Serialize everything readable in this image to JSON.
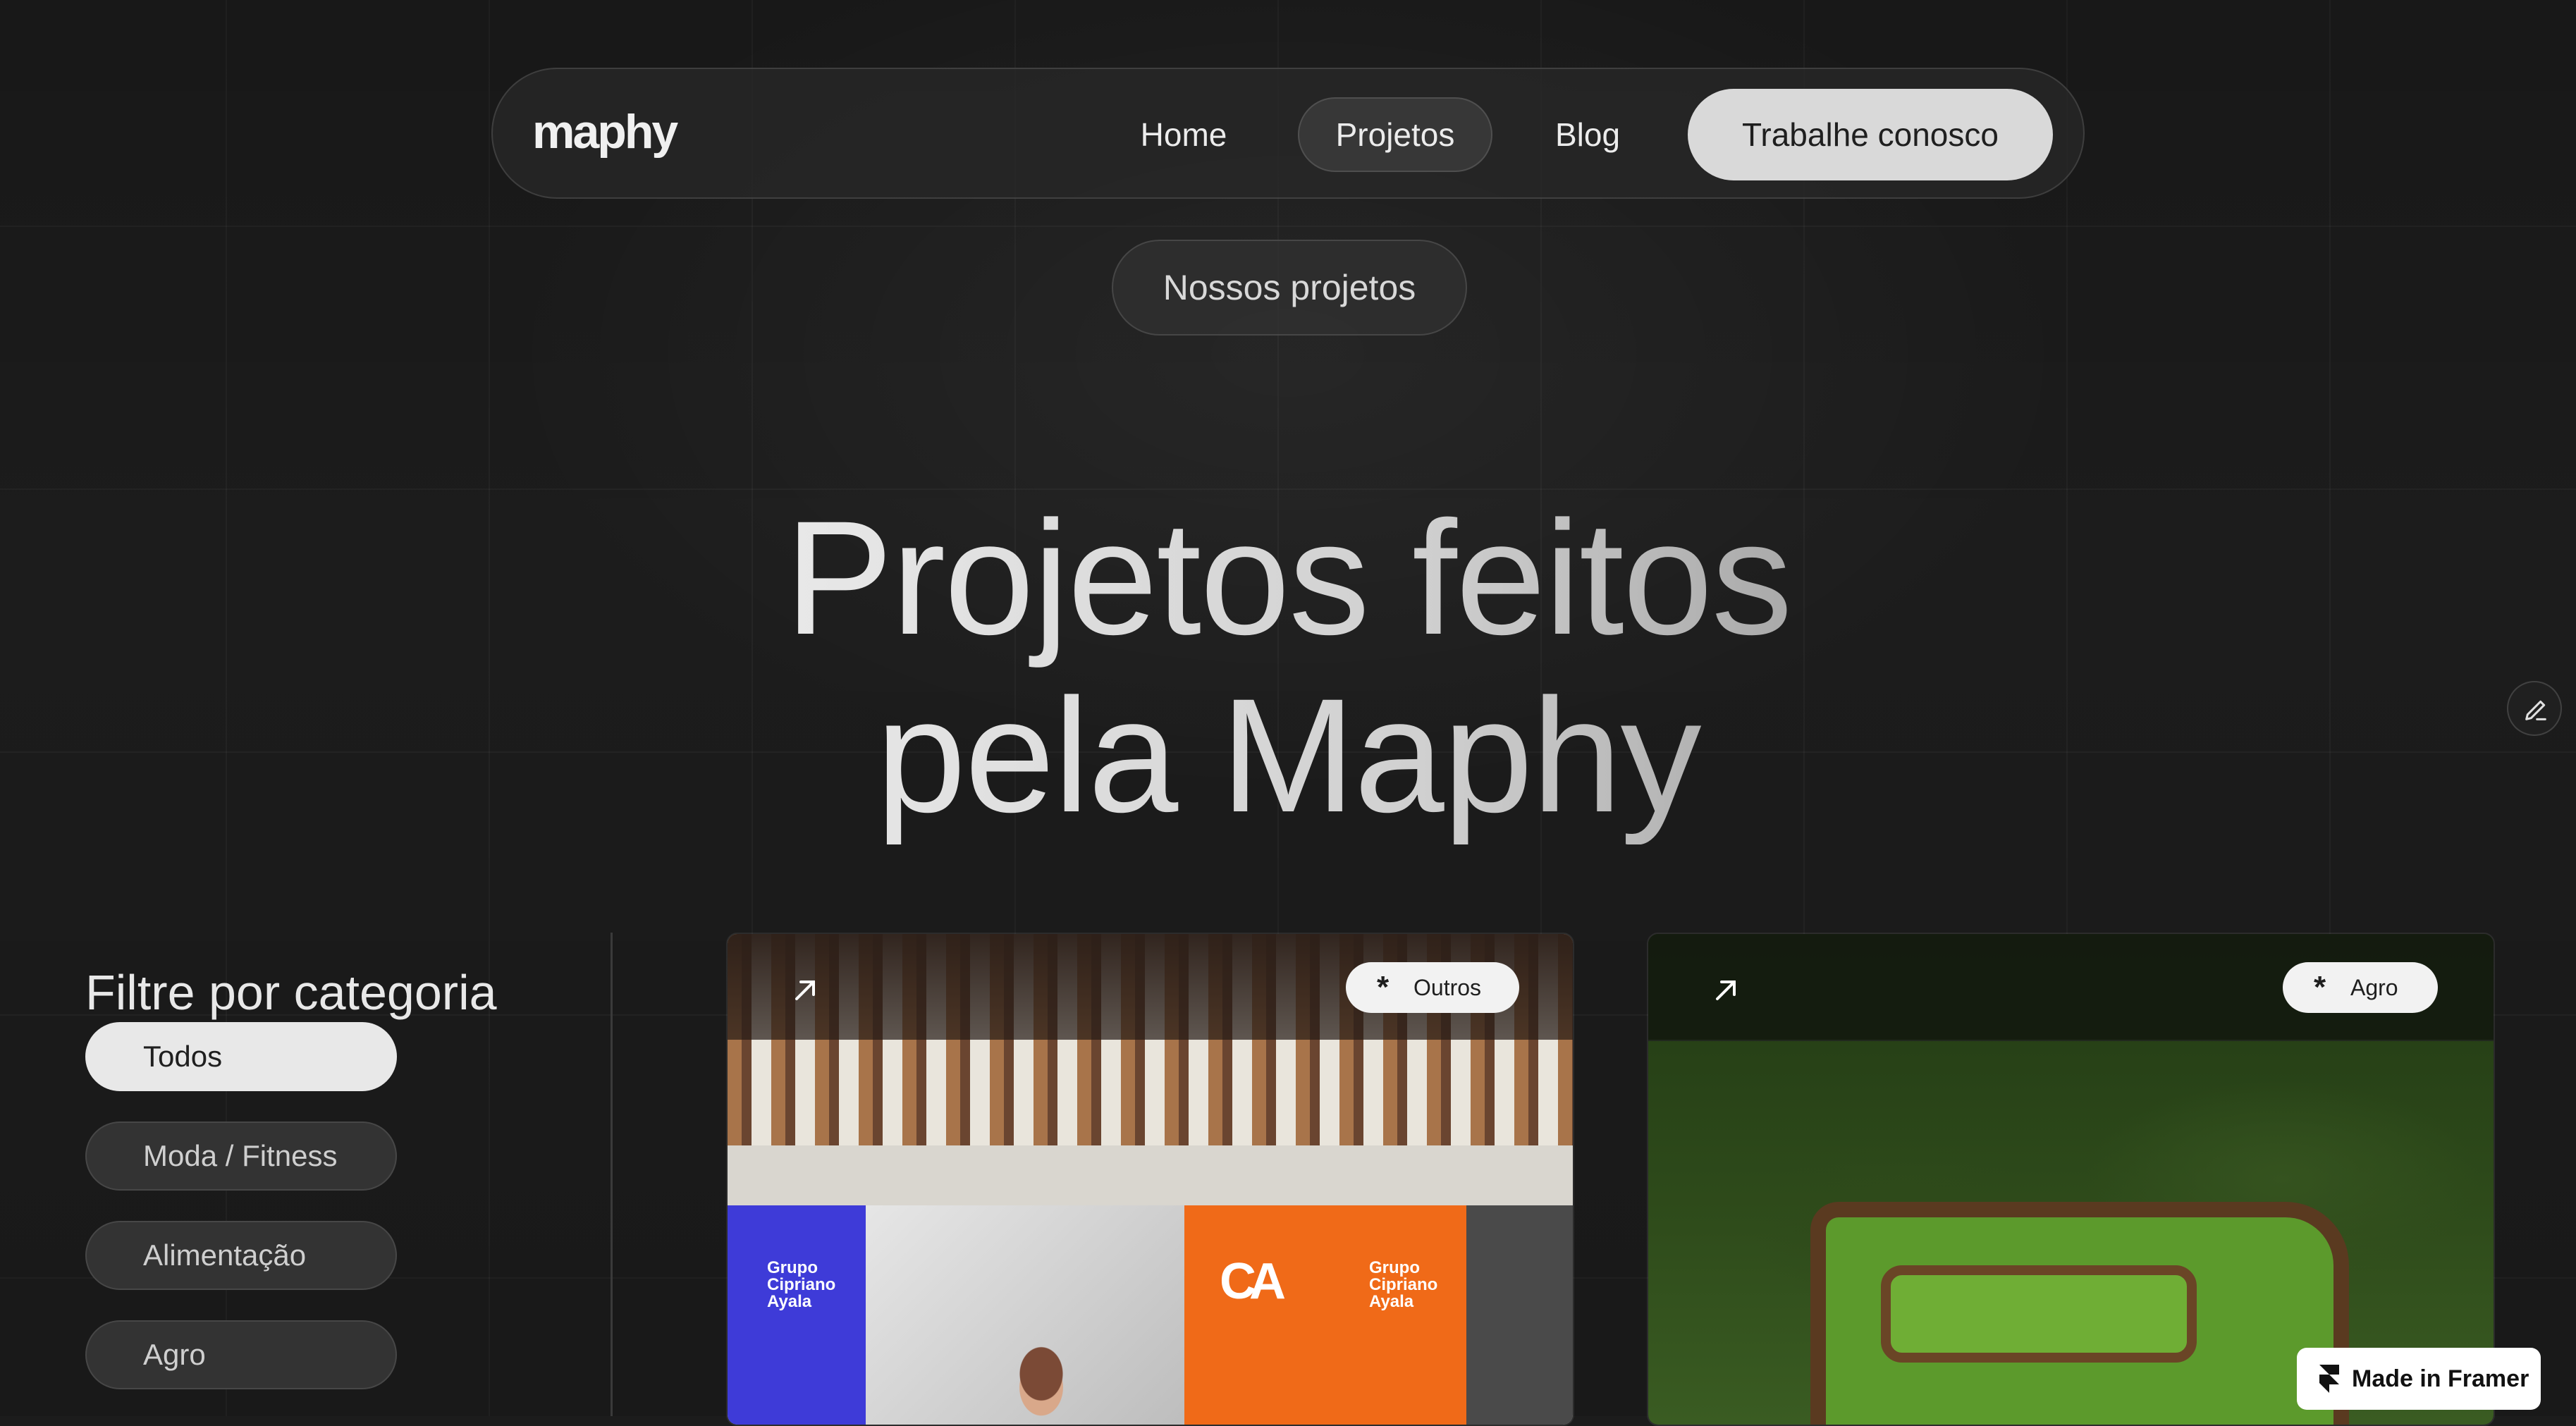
{
  "nav": {
    "logo": "maphy",
    "links": [
      "Home",
      "Projetos",
      "Blog"
    ],
    "cta": "Trabalhe conosco"
  },
  "hero": {
    "eyebrow": "Nossos projetos",
    "title_line1": "Projetos feitos",
    "title_line2": "pela Maphy"
  },
  "filters": {
    "title": "Filtre por categoria",
    "items": [
      "Todos",
      "Moda / Fitness",
      "Alimentação",
      "Agro"
    ],
    "selected": "Todos"
  },
  "cards": [
    {
      "tag": "Outros",
      "image_texts": {
        "left_brand": "Grupo\nCipriano\nAyala",
        "logo": "CA",
        "right_brand": "Grupo\nCipriano\nAyala"
      }
    },
    {
      "tag": "Agro"
    }
  ],
  "badge": {
    "label": "Made in Framer"
  },
  "icons": {
    "edit": "pencil-icon",
    "card_link": "arrow-up-right-icon",
    "tag": "asterisk-icon",
    "framer": "framer-logo-icon"
  }
}
